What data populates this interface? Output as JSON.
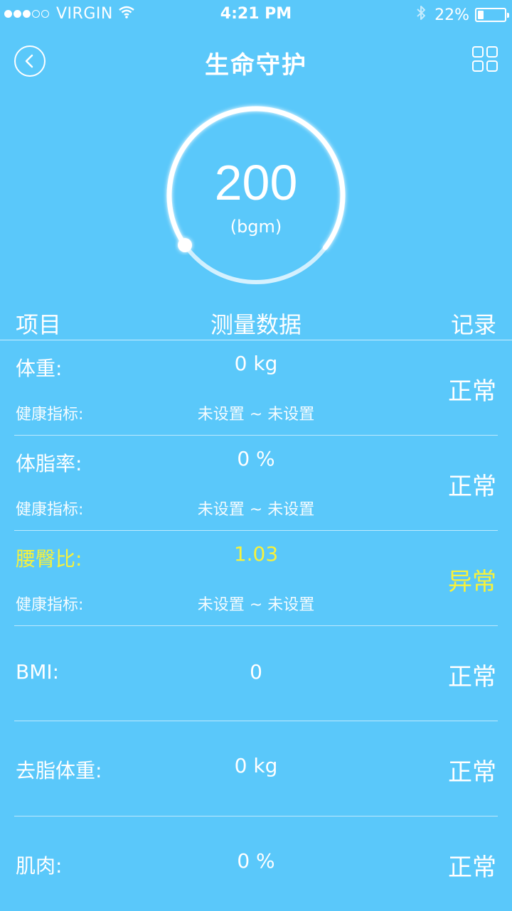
{
  "status_bar": {
    "carrier": "VIRGIN",
    "time": "4:21 PM",
    "battery_text": "22%",
    "battery_level": 0.22,
    "signal_strength": 3,
    "signal_max": 5
  },
  "nav": {
    "title": "生命守护",
    "back_icon": "chevron-left-circle-icon",
    "menu_icon": "grid-icon"
  },
  "gauge": {
    "value": "200",
    "unit": "(bgm)",
    "fraction": 0.7
  },
  "table": {
    "headers": {
      "item": "项目",
      "data": "测量数据",
      "record": "记录"
    },
    "rows": [
      {
        "name": "体重:",
        "value": "0 kg",
        "status": "正常",
        "sub_label": "健康指标:",
        "sub_range": "未设置 ~ 未设置",
        "abnormal": false
      },
      {
        "name": "体脂率:",
        "value": "0 %",
        "status": "正常",
        "sub_label": "健康指标:",
        "sub_range": "未设置 ~ 未设置",
        "abnormal": false
      },
      {
        "name": "腰臀比:",
        "value": "1.03",
        "status": "异常",
        "sub_label": "健康指标:",
        "sub_range": "未设置 ~ 未设置",
        "abnormal": true
      },
      {
        "name": "BMI:",
        "value": "0",
        "status": "正常",
        "abnormal": false
      },
      {
        "name": "去脂体重:",
        "value": "0 kg",
        "status": "正常",
        "abnormal": false
      },
      {
        "name": "肌肉:",
        "value": "0 %",
        "status": "正常",
        "abnormal": false
      }
    ]
  },
  "colors": {
    "background": "#5ac8fa",
    "text": "#ffffff",
    "abnormal": "#f8f23a"
  }
}
